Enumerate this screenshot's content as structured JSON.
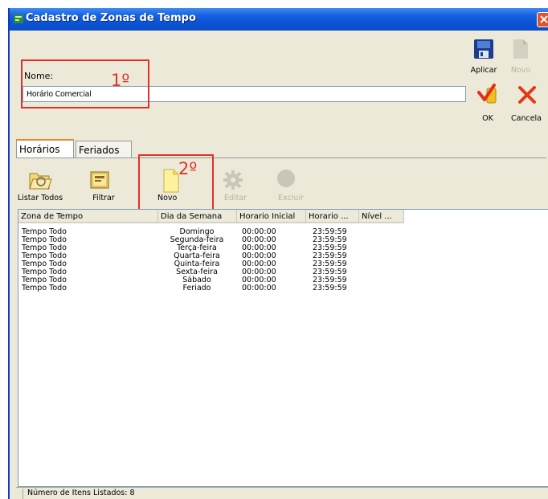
{
  "window": {
    "title": "Cadastro de Zonas de Tempo"
  },
  "form": {
    "nome_label": "Nome:",
    "nome_value": "Horário Comercial"
  },
  "annotations": {
    "first": "1º",
    "second": "2º"
  },
  "actions": {
    "aplicar": "Aplicar",
    "novo": "Novo",
    "ok": "OK",
    "cancelar": "Cancela"
  },
  "tabs": [
    {
      "label": "Horários"
    },
    {
      "label": "Feriados"
    }
  ],
  "toolbar": {
    "listar": "Listar Todos",
    "filtrar": "Filtrar",
    "novo": "Novo",
    "editar": "Editar",
    "excluir": "Excluir"
  },
  "table": {
    "columns": [
      "Zona de Tempo",
      "Dia da Semana",
      "Horario Inicial",
      "Horario ...",
      "Nível ..."
    ],
    "rows": [
      [
        "Tempo Todo",
        "Domingo",
        "00:00:00",
        "23:59:59"
      ],
      [
        "Tempo Todo",
        "Segunda-feira",
        "00:00:00",
        "23:59:59"
      ],
      [
        "Tempo Todo",
        "Terça-feira",
        "00:00:00",
        "23:59:59"
      ],
      [
        "Tempo Todo",
        "Quarta-feira",
        "00:00:00",
        "23:59:59"
      ],
      [
        "Tempo Todo",
        "Quinta-feira",
        "00:00:00",
        "23:59:59"
      ],
      [
        "Tempo Todo",
        "Sexta-feira",
        "00:00:00",
        "23:59:59"
      ],
      [
        "Tempo Todo",
        "Sábado",
        "00:00:00",
        "23:59:59"
      ],
      [
        "Tempo Todo",
        "Feriado",
        "00:00:00",
        "23:59:59"
      ]
    ]
  },
  "status": {
    "text": "Número de Itens Listados: 8"
  },
  "colors": {
    "titlebar": "#0b55d8",
    "annotation": "#e0302c",
    "window_bg": "#ece9d8"
  }
}
